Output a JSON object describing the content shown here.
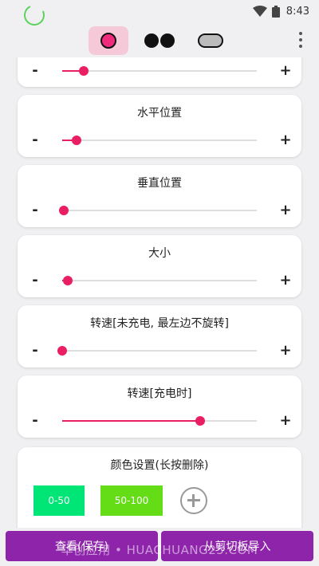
{
  "status_bar": {
    "time": "8:43"
  },
  "toolbar": {
    "tabs": [
      {
        "name": "ring",
        "active": true
      },
      {
        "name": "dots",
        "active": false
      },
      {
        "name": "pill",
        "active": false
      }
    ]
  },
  "controls": {
    "minus_label": "-",
    "plus_label": "+"
  },
  "sliders": [
    {
      "id": "partial",
      "title": "",
      "value": 0.11
    },
    {
      "id": "horizontal",
      "title": "水平位置",
      "value": 0.075
    },
    {
      "id": "vertical",
      "title": "垂直位置",
      "value": 0.01
    },
    {
      "id": "size",
      "title": "大小",
      "value": 0.03
    },
    {
      "id": "speed-uncharged",
      "title": "转速[未充电, 最左边不旋转]",
      "value": 0.0
    },
    {
      "id": "speed-charging",
      "title": "转速[充电时]",
      "value": 0.71
    }
  ],
  "colors": {
    "title": "颜色设置(长按删除)",
    "chips": [
      {
        "label": "0-50",
        "color": "#00e676"
      },
      {
        "label": "50-100",
        "color": "#64dd17"
      }
    ]
  },
  "buttons": {
    "view_save": "查看(保存)",
    "import_clipboard": "从剪切板导入"
  },
  "watermark": "华创应用 • HUACHUANG25.COM",
  "accent": "#e91e63",
  "button_color": "#8e24aa"
}
